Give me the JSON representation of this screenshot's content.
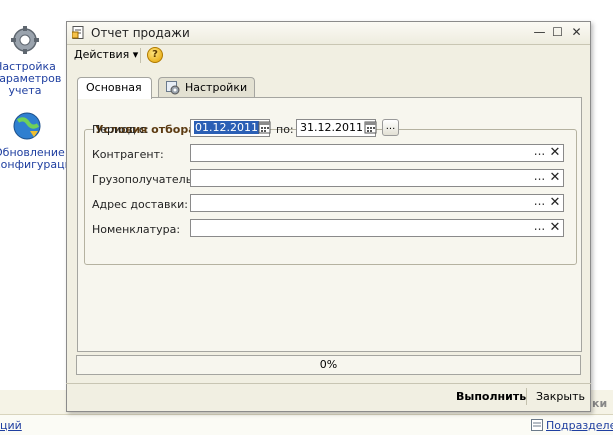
{
  "desktop": {
    "shortcut_settings": [
      "Настройка",
      "параметров",
      "учета"
    ],
    "shortcut_update": [
      "Обновление",
      "конфигурации"
    ],
    "bottom_left_link": "ций",
    "bottom_right_link": "Подразделен",
    "side_text_1": "ки",
    "side_text_2": "ки"
  },
  "window": {
    "title": "Отчет продажи",
    "controls": {
      "minimize": "—",
      "maximize": "☐",
      "close": "✕"
    },
    "toolbar": {
      "actions_label": "Действия ▾",
      "help_label": "?"
    },
    "tabs": [
      {
        "label": "Основная",
        "active": true
      },
      {
        "label": "Настройки",
        "active": false
      }
    ],
    "filter_group": {
      "title": "Условия отбора",
      "period_label": "Период с:",
      "date_from": "01.12.2011",
      "to_label": "по:",
      "date_to": "31.12.2011",
      "period_button": "...",
      "fields": [
        {
          "label": "Контрагент:",
          "value": ""
        },
        {
          "label": "Грузополучатель:",
          "value": ""
        },
        {
          "label": "Адрес доставки:",
          "value": ""
        },
        {
          "label": "Номенклатура:",
          "value": ""
        }
      ],
      "select_button": "...",
      "clear_button": "✕"
    },
    "progress": {
      "percent": 0,
      "label": "0%"
    },
    "footer": {
      "run_label": "Выполнить",
      "close_label": "Закрыть"
    }
  },
  "colors": {
    "accent_title": "#5c3b12",
    "selection": "#2b5fb5",
    "link": "#1f3fa0"
  }
}
